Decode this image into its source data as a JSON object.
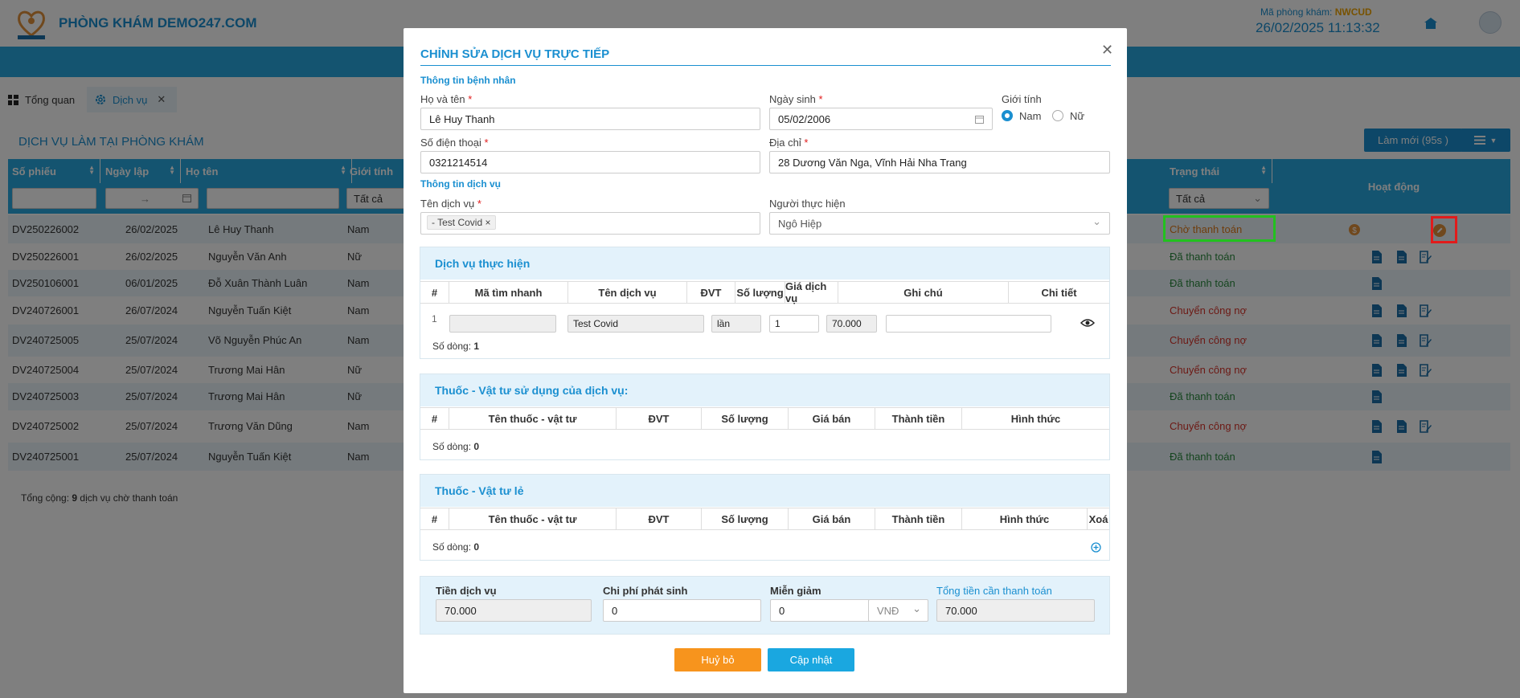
{
  "header": {
    "brand": "PHÒNG KHÁM DEMO247.COM",
    "clinic_code_label": "Mã phòng khám: ",
    "clinic_code": "NWCUD",
    "datetime": "26/02/2025 11:13:32"
  },
  "tabs": [
    {
      "label": "Tổng quan"
    },
    {
      "label": "Dịch vụ"
    }
  ],
  "page": {
    "title": "DỊCH VỤ LÀM TẠI PHÒNG KHÁM",
    "refresh_label": "Làm mới (95s )",
    "total_label": "Tổng cộng: ",
    "total_count": "9",
    "total_suffix": " dịch vụ chờ thanh toán"
  },
  "table": {
    "columns": [
      "Số phiếu",
      "Ngày lập",
      "Họ tên",
      "Giới tính",
      "Trạng thái",
      "Hoạt động"
    ],
    "filter_gender": "Tất cả",
    "filter_status": "Tất cả",
    "date_arrow": "→",
    "rows": [
      {
        "id": "DV250226002",
        "date": "26/02/2025",
        "name": "Lê Huy Thanh",
        "gender": "Nam",
        "status": "Chờ thanh toán"
      },
      {
        "id": "DV250226001",
        "date": "26/02/2025",
        "name": "Nguyễn Văn Anh",
        "gender": "Nữ",
        "status": "Đã thanh toán"
      },
      {
        "id": "DV250106001",
        "date": "06/01/2025",
        "name": "Đỗ Xuân Thành Luân",
        "gender": "Nam",
        "status": "Đã thanh toán"
      },
      {
        "id": "DV240726001",
        "date": "26/07/2024",
        "name": "Nguyễn Tuấn Kiệt",
        "gender": "Nam",
        "status": "Chuyển công nợ"
      },
      {
        "id": "DV240725005",
        "date": "25/07/2024",
        "name": "Võ Nguyễn Phúc An",
        "gender": "Nam",
        "status": "Chuyển công nợ"
      },
      {
        "id": "DV240725004",
        "date": "25/07/2024",
        "name": "Trương Mai Hân",
        "gender": "Nữ",
        "status": "Chuyển công nợ"
      },
      {
        "id": "DV240725003",
        "date": "25/07/2024",
        "name": "Trương Mai Hân",
        "gender": "Nữ",
        "status": "Đã thanh toán"
      },
      {
        "id": "DV240725002",
        "date": "25/07/2024",
        "name": "Trương Văn Dũng",
        "gender": "Nam",
        "status": "Chuyển công nợ"
      },
      {
        "id": "DV240725001",
        "date": "25/07/2024",
        "name": "Nguyễn Tuấn Kiệt",
        "gender": "Nam",
        "status": "Đã thanh toán"
      }
    ]
  },
  "modal": {
    "title": "CHỈNH SỬA DỊCH VỤ TRỰC TIẾP",
    "patient_section": "Thông tin bệnh nhân",
    "name_label": "Họ và tên",
    "name_value": "Lê Huy Thanh",
    "dob_label": "Ngày sinh",
    "dob_value": "05/02/2006",
    "gender_label": "Giới tính",
    "gender_male": "Nam",
    "gender_female": "Nữ",
    "phone_label": "Số điện thoại",
    "phone_value": "0321214514",
    "address_label": "Địa chỉ",
    "address_value": "28 Dương Văn Nga, Vĩnh Hải Nha Trang",
    "service_section": "Thông tin dịch vụ",
    "service_name_label": "Tên dịch vụ",
    "service_chip": "- Test Covid",
    "performer_label": "Người thực hiện",
    "performer_value": "Ngô Hiệp",
    "req_mark": "*",
    "performed": {
      "title": "Dịch vụ thực hiện",
      "columns": [
        "#",
        "Mã tìm nhanh",
        "Tên dịch vụ",
        "ĐVT",
        "Số lượng",
        "Giá dịch vụ",
        "Ghi chú",
        "Chi tiết"
      ],
      "row": {
        "no": "1",
        "code": "",
        "name": "Test Covid",
        "unit": "lần",
        "qty": "1",
        "price": "70.000",
        "note": ""
      },
      "rows_label": "Số dòng: ",
      "rows_count": "1"
    },
    "materials": {
      "title": "Thuốc - Vật tư sử dụng của dịch vụ:",
      "columns": [
        "#",
        "Tên thuốc - vật tư",
        "ĐVT",
        "Số lượng",
        "Giá bán",
        "Thành tiền",
        "Hình thức"
      ],
      "rows_label": "Số dòng: ",
      "rows_count": "0"
    },
    "retail": {
      "title": "Thuốc - Vật tư lẻ",
      "columns": [
        "#",
        "Tên thuốc - vật tư",
        "ĐVT",
        "Số lượng",
        "Giá bán",
        "Thành tiền",
        "Hình thức",
        "Xoá"
      ],
      "rows_label": "Số dòng: ",
      "rows_count": "0"
    },
    "payment": {
      "service_fee_label": "Tiền dịch vụ",
      "service_fee": "70.000",
      "extra_label": "Chi phí phát sinh",
      "extra": "0",
      "discount_label": "Miễn giảm",
      "discount": "0",
      "currency": "VNĐ",
      "total_label": "Tổng tiền cần thanh toán",
      "total": "70.000"
    },
    "cancel_label": "Huỷ bỏ",
    "update_label": "Cập nhật"
  },
  "colors": {
    "primary": "#1a8fd0",
    "nav": "#29a8e0",
    "cancel": "#f7941d",
    "highlight_green": "#22c11f",
    "highlight_red": "#e11b1b"
  }
}
